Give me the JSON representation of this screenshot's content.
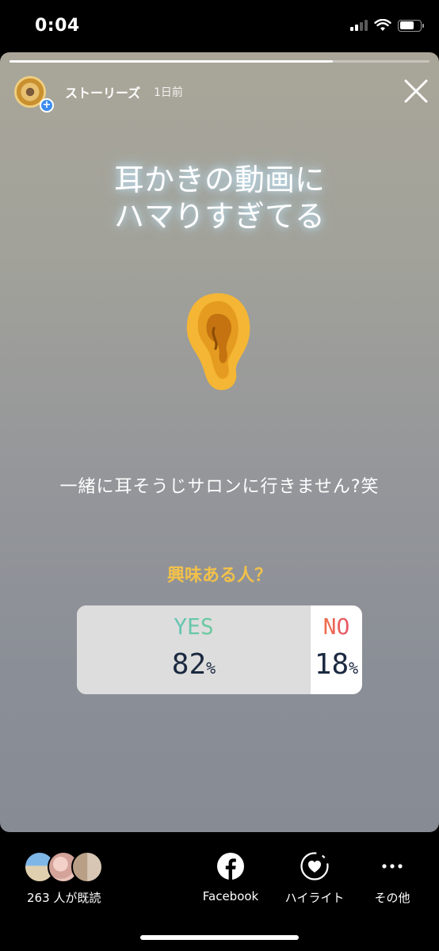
{
  "status_bar": {
    "time": "0:04"
  },
  "story": {
    "progress": 0.77,
    "username": "ストーリーズ",
    "posted": "1日前",
    "headline_line1": "耳かきの動画に",
    "headline_line2": "ハマりすぎてる",
    "subtitle": "一緒に耳そうじサロンに行きません?笑",
    "poll": {
      "question": "興味ある人？",
      "yes_label": "YES",
      "yes_percent": "82",
      "no_label": "NO",
      "no_percent": "18",
      "percent_unit": "%"
    }
  },
  "bottom_bar": {
    "viewer_count": "263 人が既読",
    "facebook_label": "Facebook",
    "highlight_label": "ハイライト",
    "more_label": "その他"
  }
}
